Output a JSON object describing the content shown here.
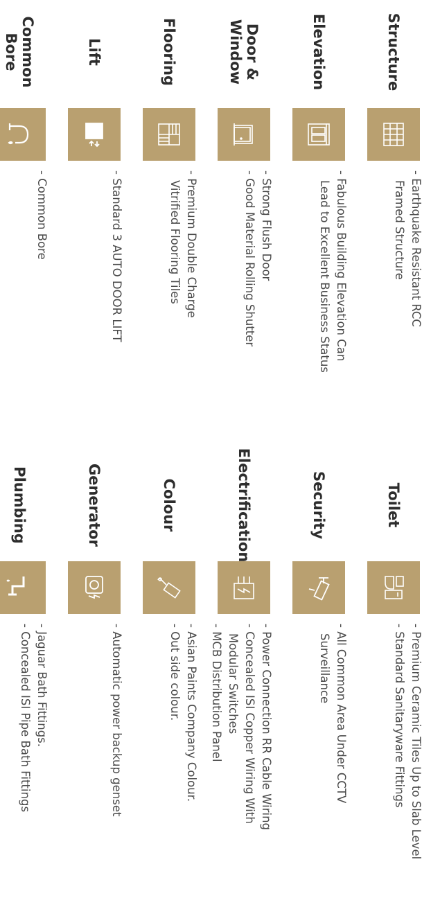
{
  "left_column": [
    {
      "title": "Structure",
      "icon": "structure-frame-icon",
      "lines": [
        "- Earthquake Resistant RCC",
        "  Framed Structure"
      ]
    },
    {
      "title": "Elevation",
      "icon": "building-elevation-icon",
      "lines": [
        "- Fabulous Building Elevation Can",
        "  Lead to Excellent Business Status"
      ]
    },
    {
      "title": "Door &\nWindow",
      "icon": "door-window-icon",
      "lines": [
        "- Strong Flush Door",
        "- Good Material Rolling Shutter"
      ]
    },
    {
      "title": "Flooring",
      "icon": "floor-tiles-icon",
      "lines": [
        "- Premium Double Charge",
        "  Vitrified Flooring Tiles"
      ]
    },
    {
      "title": "Lift",
      "icon": "lift-icon",
      "lines": [
        "- Standard 3 AUTO DOOR LIFT"
      ]
    },
    {
      "title": "Common\nBore",
      "icon": "water-tap-icon",
      "lines": [
        "- Common Bore"
      ]
    }
  ],
  "right_column": [
    {
      "title": "Toilet",
      "icon": "toilet-sanitary-icon",
      "lines": [
        "- Premium Ceramic Tiles Up to Slab Level",
        "- Standard Sanitaryware Fittings"
      ]
    },
    {
      "title": "Security",
      "icon": "cctv-camera-icon",
      "lines": [
        "- All Common Area Under CCTV",
        "  Surveillance"
      ]
    },
    {
      "title": "Electrification",
      "icon": "electric-panel-icon",
      "lines": [
        "- Power Connection RR Cable Wiring",
        "- Concealed ISI Copper Wiring With",
        "  Modular Switches",
        "- MCB Distribution Panel"
      ]
    },
    {
      "title": "Colour",
      "icon": "paint-roller-icon",
      "lines": [
        "- Asian Paints Company Colour.",
        "- Out side colour."
      ]
    },
    {
      "title": "Generator",
      "icon": "generator-icon",
      "lines": [
        "- Automatic power backup genset"
      ]
    },
    {
      "title": "Plumbing",
      "icon": "plumbing-pipe-icon",
      "lines": [
        "- Jaguar Bath Fittings.",
        "- Concealed ISI Pipe Bath Fittings"
      ]
    }
  ],
  "colors": {
    "badge": "#b9a070",
    "title": "#2d2d2d",
    "text": "#4a4a4a"
  }
}
